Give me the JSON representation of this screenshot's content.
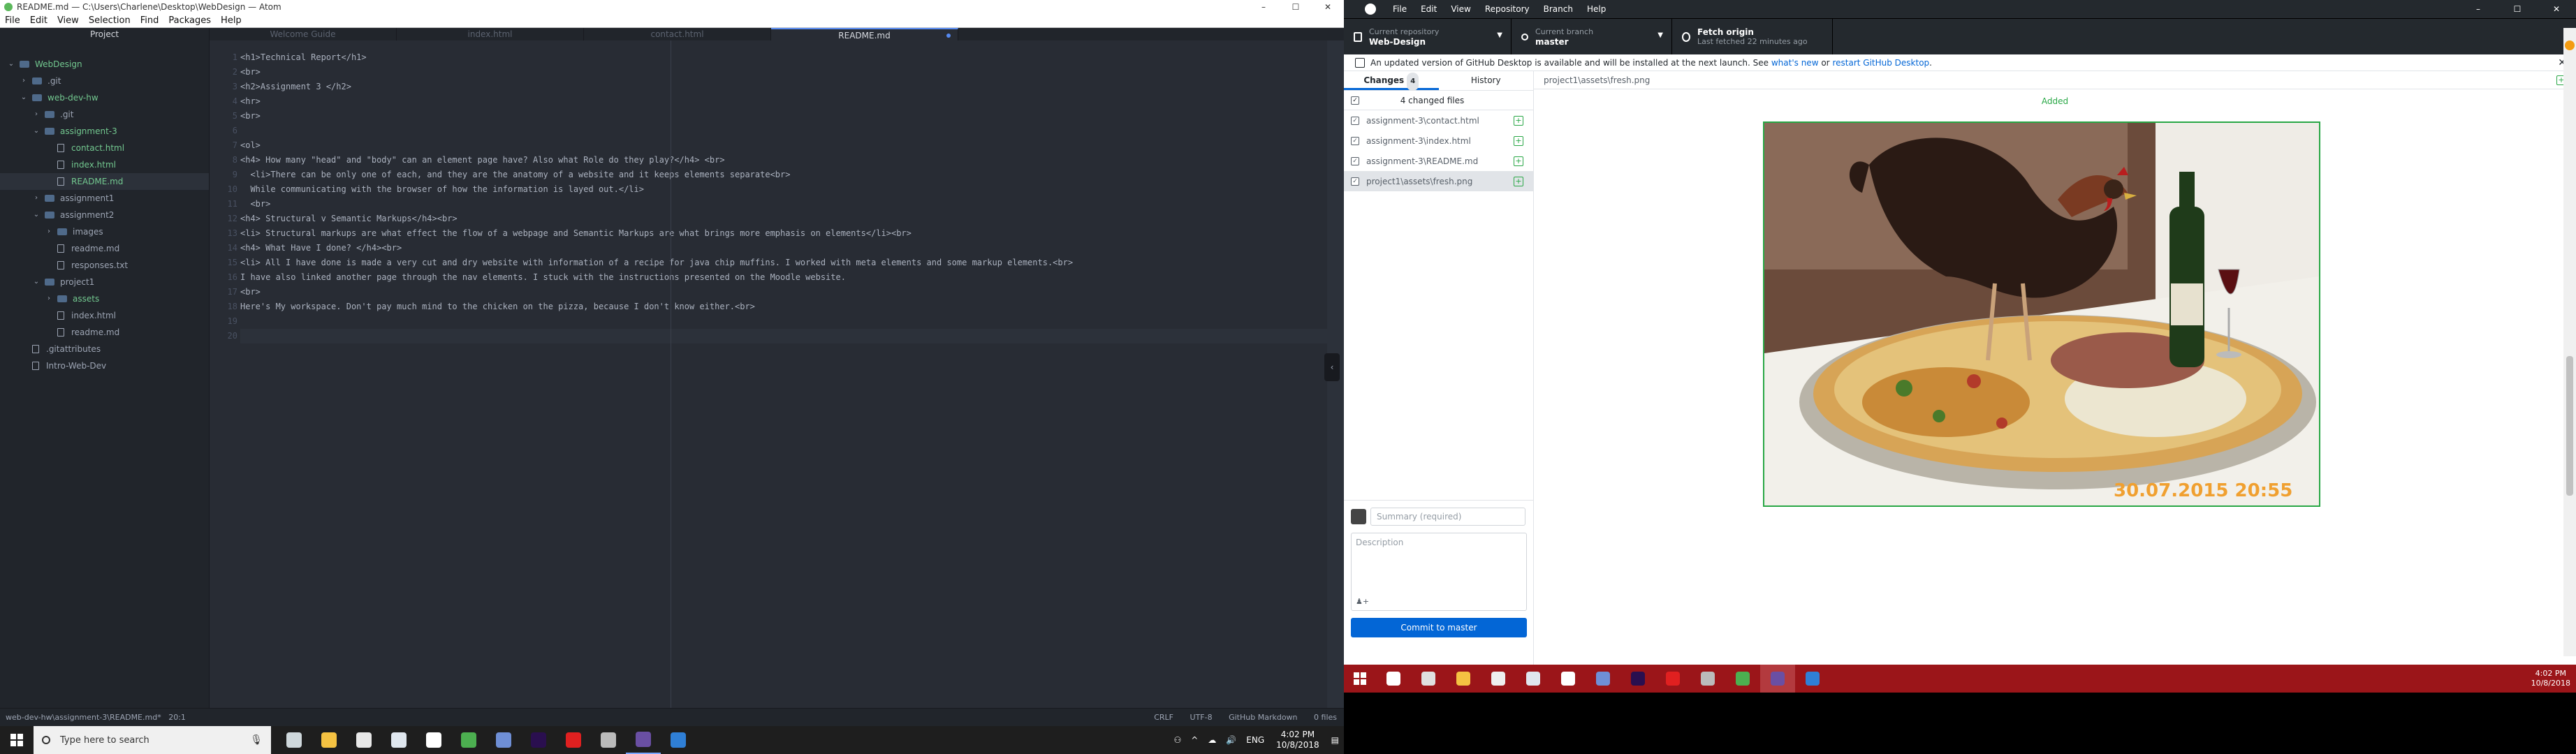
{
  "atom": {
    "title": "README.md — C:\\Users\\Charlene\\Desktop\\WebDesign — Atom",
    "window_controls": [
      "–",
      "☐",
      "✕"
    ],
    "menu": [
      "File",
      "Edit",
      "View",
      "Selection",
      "Find",
      "Packages",
      "Help"
    ],
    "project_tab": "Project",
    "tabs": [
      {
        "label": "Welcome Guide",
        "active": false
      },
      {
        "label": "index.html",
        "active": false
      },
      {
        "label": "contact.html",
        "active": false
      },
      {
        "label": "README.md",
        "active": true
      }
    ],
    "tree": [
      {
        "label": "WebDesign",
        "type": "folder",
        "open": true,
        "depth": 0,
        "color": "green"
      },
      {
        "label": ".git",
        "type": "folder",
        "open": false,
        "depth": 1
      },
      {
        "label": "web-dev-hw",
        "type": "folder",
        "open": true,
        "depth": 1,
        "color": "green"
      },
      {
        "label": ".git",
        "type": "folder",
        "open": false,
        "depth": 2
      },
      {
        "label": "assignment-3",
        "type": "folder",
        "open": true,
        "depth": 2,
        "color": "green"
      },
      {
        "label": "contact.html",
        "type": "file",
        "depth": 3,
        "color": "green"
      },
      {
        "label": "index.html",
        "type": "file",
        "depth": 3,
        "color": "green"
      },
      {
        "label": "README.md",
        "type": "file",
        "depth": 3,
        "color": "green",
        "selected": true
      },
      {
        "label": "assignment1",
        "type": "folder",
        "open": false,
        "depth": 2
      },
      {
        "label": "assignment2",
        "type": "folder",
        "open": true,
        "depth": 2
      },
      {
        "label": "images",
        "type": "folder",
        "open": false,
        "depth": 3
      },
      {
        "label": "readme.md",
        "type": "file",
        "depth": 3
      },
      {
        "label": "responses.txt",
        "type": "file",
        "depth": 3
      },
      {
        "label": "project1",
        "type": "folder",
        "open": true,
        "depth": 2
      },
      {
        "label": "assets",
        "type": "folder",
        "open": false,
        "depth": 3,
        "color": "green"
      },
      {
        "label": "index.html",
        "type": "file",
        "depth": 3
      },
      {
        "label": "readme.md",
        "type": "file",
        "depth": 3
      },
      {
        "label": ".gitattributes",
        "type": "file",
        "depth": 1
      },
      {
        "label": "Intro-Web-Dev",
        "type": "file",
        "depth": 1
      }
    ],
    "lines": [
      {
        "n": "1",
        "text": "<h1>Technical Report</h1>"
      },
      {
        "n": "2",
        "text": "<br>"
      },
      {
        "n": "3",
        "text": "<h2>Assignment 3 </h2>"
      },
      {
        "n": "4",
        "text": "<hr>"
      },
      {
        "n": "5",
        "text": "<br>"
      },
      {
        "n": "6",
        "text": ""
      },
      {
        "n": "7",
        "text": "<ol>"
      },
      {
        "n": "8",
        "text": "<h4> How many \"head\" and \"body\" can an element page have? Also what Role do they play?</h4> <br>"
      },
      {
        "n": "9",
        "text": "  <li>There can be only one of each, and they are the anatomy of a website and it keeps elements separate<br>"
      },
      {
        "n": "10",
        "text": "  While communicating with the browser of how the information is layed out.</li>"
      },
      {
        "n": "11",
        "text": "  <br>"
      },
      {
        "n": "12",
        "text": "<h4> Structural v Semantic Markups</h4><br>"
      },
      {
        "n": "13",
        "text": "<li> Structural markups are what effect the flow of a webpage and Semantic Markups are what brings more emphasis on elements</li><br>"
      },
      {
        "n": "14",
        "text": "<h4> What Have I done? </h4><br>"
      },
      {
        "n": "15",
        "text": "<li> All I have done is made a very cut and dry website with information of a recipe for java chip muffins. I worked with meta elements and some markup elements.<br>"
      },
      {
        "n": "16",
        "text": "I have also linked another page through the nav elements. I stuck with the instructions presented on the Moodle website."
      },
      {
        "n": "17",
        "text": "<br>"
      },
      {
        "n": "18",
        "text": "Here's My workspace. Don't pay much mind to the chicken on the pizza, because I don't know either.<br>"
      },
      {
        "n": "19",
        "text": ""
      },
      {
        "n": "20",
        "text": ""
      }
    ],
    "status": {
      "path": "web-dev-hw\\assignment-3\\README.md*",
      "cursor": "20:1",
      "line_ending": "CRLF",
      "encoding": "UTF-8",
      "grammar": "GitHub Markdown",
      "files": "0 files"
    }
  },
  "taskbar_left": {
    "search_placeholder": "Type here to search",
    "apps": [
      {
        "name": "task-view",
        "color": "#cfd8dc"
      },
      {
        "name": "file-explorer",
        "color": "#f5c242"
      },
      {
        "name": "store",
        "color": "#e8e8e8"
      },
      {
        "name": "mail",
        "color": "#dfe6ee"
      },
      {
        "name": "sticky",
        "color": "#ffffff"
      },
      {
        "name": "chrome",
        "color": "#4caf50"
      },
      {
        "name": "photos",
        "color": "#6f8fd6"
      },
      {
        "name": "premiere",
        "color": "#2a0f4f"
      },
      {
        "name": "acrobat",
        "color": "#e02020"
      },
      {
        "name": "settings",
        "color": "#bbbbbb"
      },
      {
        "name": "video",
        "color": "#6a4fa3",
        "running": true
      },
      {
        "name": "edge",
        "color": "#2f7fd6"
      }
    ],
    "tray": [
      "ENG"
    ],
    "time": "4:02 PM",
    "date": "10/8/2018"
  },
  "github": {
    "menu": [
      "File",
      "Edit",
      "View",
      "Repository",
      "Branch",
      "Help"
    ],
    "window_controls": [
      "–",
      "☐",
      "✕"
    ],
    "repo_label": "Current repository",
    "repo": "Web-Design",
    "branch_label": "Current branch",
    "branch": "master",
    "fetch_label": "Fetch origin",
    "fetch_sub": "Last fetched 22 minutes ago",
    "banner_text": "An updated version of GitHub Desktop is available and will be installed at the next launch. See",
    "banner_link1": "what's new",
    "banner_or": "or",
    "banner_link2": "restart GitHub Desktop",
    "banner_end": ".",
    "tab_changes": "Changes",
    "tab_changes_count": "4",
    "tab_history": "History",
    "changed_files_label": "4 changed files",
    "files": [
      {
        "name": "assignment-3\\contact.html",
        "selected": false
      },
      {
        "name": "assignment-3\\index.html",
        "selected": false
      },
      {
        "name": "assignment-3\\README.md",
        "selected": false
      },
      {
        "name": "project1\\assets\\fresh.png",
        "selected": true
      }
    ],
    "diff_path": "project1\\assets\\fresh.png",
    "diff_status": "Added",
    "image_stamp": "30.07.2015 20:55",
    "summary_placeholder": "Summary (required)",
    "description_placeholder": "Description",
    "commit_button": "Commit to master"
  },
  "taskbar_right": {
    "apps": [
      {
        "name": "cortana",
        "color": "#ffffff"
      },
      {
        "name": "task-view",
        "color": "#e0e0e0"
      },
      {
        "name": "file-explorer",
        "color": "#f5c242"
      },
      {
        "name": "store",
        "color": "#eeeeee"
      },
      {
        "name": "mail",
        "color": "#dfe6ee"
      },
      {
        "name": "sticky",
        "color": "#ffffff"
      },
      {
        "name": "photos",
        "color": "#6f8fd6"
      },
      {
        "name": "premiere",
        "color": "#2a0f4f"
      },
      {
        "name": "acrobat",
        "color": "#e02020"
      },
      {
        "name": "settings",
        "color": "#bbbbbb"
      },
      {
        "name": "chrome",
        "color": "#4caf50"
      },
      {
        "name": "video",
        "color": "#6a4fa3",
        "running": true
      },
      {
        "name": "edge",
        "color": "#2f7fd6"
      }
    ],
    "time": "4:02 PM",
    "date": "10/8/2018"
  }
}
